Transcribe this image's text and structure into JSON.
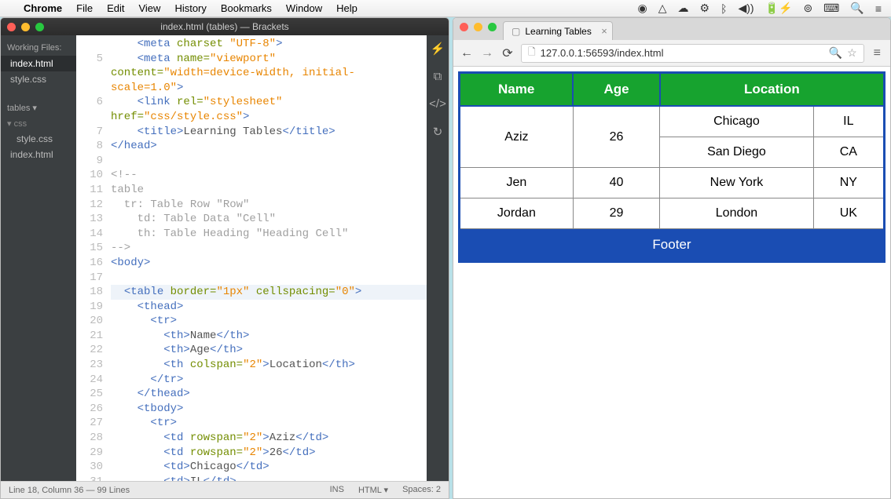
{
  "menubar": {
    "app": "Chrome",
    "items": [
      "File",
      "Edit",
      "View",
      "History",
      "Bookmarks",
      "Window",
      "Help"
    ]
  },
  "brackets": {
    "title": "index.html (tables) — Brackets",
    "sidebar": {
      "working_label": "Working Files:",
      "working": [
        "index.html",
        "style.css"
      ],
      "project_label": "tables ▾",
      "tree": [
        {
          "label": "css",
          "cls": ""
        },
        {
          "label": "style.css",
          "cls": "indented"
        },
        {
          "label": "index.html",
          "cls": ""
        }
      ]
    },
    "code_lines": [
      {
        "n": "",
        "html": "    <span class='tag'>&lt;meta</span> <span class='attr'>charset</span> <span class='val'>\"UTF-8\"</span><span class='tag'>&gt;</span>"
      },
      {
        "n": "5",
        "html": "    <span class='tag'>&lt;meta</span> <span class='attr'>name=</span><span class='val'>\"viewport\"</span>"
      },
      {
        "n": "",
        "html": "<span class='attr'>content=</span><span class='val'>\"width=device-width, initial-</span>"
      },
      {
        "n": "",
        "html": "<span class='val'>scale=1.0\"</span><span class='tag'>&gt;</span>"
      },
      {
        "n": "6",
        "html": "    <span class='tag'>&lt;link</span> <span class='attr'>rel=</span><span class='val'>\"stylesheet\"</span>"
      },
      {
        "n": "",
        "html": "<span class='attr'>href=</span><span class='val'>\"css/style.css\"</span><span class='tag'>&gt;</span>"
      },
      {
        "n": "7",
        "html": "    <span class='tag'>&lt;title&gt;</span><span class='txt'>Learning Tables</span><span class='tag'>&lt;/title&gt;</span>"
      },
      {
        "n": "8",
        "html": "<span class='tag'>&lt;/head&gt;</span>"
      },
      {
        "n": "9",
        "html": ""
      },
      {
        "n": "10",
        "html": "<span class='comment'>&lt;!--</span>"
      },
      {
        "n": "11",
        "html": "<span class='comment'>table</span>"
      },
      {
        "n": "12",
        "html": "<span class='comment'>  tr: Table Row \"Row\"</span>"
      },
      {
        "n": "13",
        "html": "<span class='comment'>    td: Table Data \"Cell\"</span>"
      },
      {
        "n": "14",
        "html": "<span class='comment'>    th: Table Heading \"Heading Cell\"</span>"
      },
      {
        "n": "15",
        "html": "<span class='comment'>--&gt;</span>"
      },
      {
        "n": "16",
        "html": "<span class='tag'>&lt;body&gt;</span>"
      },
      {
        "n": "17",
        "html": ""
      },
      {
        "n": "18",
        "html": "  <span class='tag'>&lt;table</span> <span class='attr'>border=</span><span class='val'>\"1px\"</span> <span class='attr'>cellspacing=</span><span class='val'>\"0\"</span><span class='tag'>&gt;</span>",
        "hl": true
      },
      {
        "n": "19",
        "html": "    <span class='tag'>&lt;thead&gt;</span>"
      },
      {
        "n": "20",
        "html": "      <span class='tag'>&lt;tr&gt;</span>"
      },
      {
        "n": "21",
        "html": "        <span class='tag'>&lt;th&gt;</span><span class='txt'>Name</span><span class='tag'>&lt;/th&gt;</span>"
      },
      {
        "n": "22",
        "html": "        <span class='tag'>&lt;th&gt;</span><span class='txt'>Age</span><span class='tag'>&lt;/th&gt;</span>"
      },
      {
        "n": "23",
        "html": "        <span class='tag'>&lt;th</span> <span class='attr'>colspan=</span><span class='val'>\"2\"</span><span class='tag'>&gt;</span><span class='txt'>Location</span><span class='tag'>&lt;/th&gt;</span>"
      },
      {
        "n": "24",
        "html": "      <span class='tag'>&lt;/tr&gt;</span>"
      },
      {
        "n": "25",
        "html": "    <span class='tag'>&lt;/thead&gt;</span>"
      },
      {
        "n": "26",
        "html": "    <span class='tag'>&lt;tbody&gt;</span>"
      },
      {
        "n": "27",
        "html": "      <span class='tag'>&lt;tr&gt;</span>"
      },
      {
        "n": "28",
        "html": "        <span class='tag'>&lt;td</span> <span class='attr'>rowspan=</span><span class='val'>\"2\"</span><span class='tag'>&gt;</span><span class='txt'>Aziz</span><span class='tag'>&lt;/td&gt;</span>"
      },
      {
        "n": "29",
        "html": "        <span class='tag'>&lt;td</span> <span class='attr'>rowspan=</span><span class='val'>\"2\"</span><span class='tag'>&gt;</span><span class='txt'>26</span><span class='tag'>&lt;/td&gt;</span>"
      },
      {
        "n": "30",
        "html": "        <span class='tag'>&lt;td&gt;</span><span class='txt'>Chicago</span><span class='tag'>&lt;/td&gt;</span>"
      },
      {
        "n": "31",
        "html": "        <span class='tag'>&lt;td&gt;</span><span class='txt'>IL</span><span class='tag'>&lt;/td&gt;</span>"
      }
    ],
    "status": {
      "left": "Line 18, Column 36 — 99 Lines",
      "ins": "INS",
      "lang": "HTML ▾",
      "spaces": "Spaces: 2"
    }
  },
  "chrome": {
    "tab_title": "Learning Tables",
    "url": "127.0.0.1:56593/index.html",
    "table": {
      "headers": [
        "Name",
        "Age",
        "Location"
      ],
      "rows": [
        {
          "name": "Aziz",
          "age": "26",
          "city": "Chicago",
          "state": "IL",
          "rowspan": true
        },
        {
          "city": "San Diego",
          "state": "CA"
        },
        {
          "name": "Jen",
          "age": "40",
          "city": "New York",
          "state": "NY"
        },
        {
          "name": "Jordan",
          "age": "29",
          "city": "London",
          "state": "UK"
        }
      ],
      "footer": "Footer"
    }
  }
}
